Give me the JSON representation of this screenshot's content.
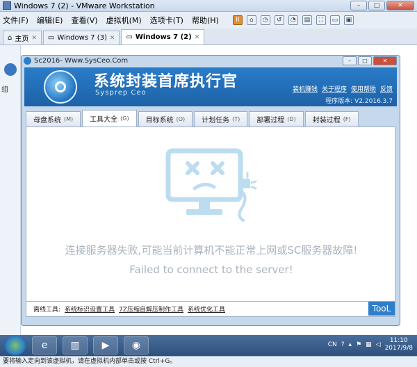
{
  "vm": {
    "title": "Windows 7 (2) - VMware Workstation",
    "menu": [
      "文件(F)",
      "编辑(E)",
      "查看(V)",
      "虚拟机(M)",
      "选项卡(T)",
      "帮助(H)"
    ],
    "tabs": [
      {
        "label": "主页"
      },
      {
        "label": "Windows 7 (3)"
      },
      {
        "label": "Windows 7 (2)"
      }
    ],
    "status": "要将输入定向到该虚拟机，请在虚拟机内部单击或按 Ctrl+G。"
  },
  "guest": {
    "left_text": "组"
  },
  "app": {
    "window_title": "Sc2016- Www.SysCeo.Com",
    "name": "系统封装首席执行官",
    "subtitle": "Sysprep  Ceo",
    "links": [
      "装机赚钱",
      "关于程序",
      "使用帮助",
      "反馈"
    ],
    "version": "程序版本: V2.2016.3.7",
    "tabs": [
      {
        "label": "母盘系统",
        "key": "(M)"
      },
      {
        "label": "工具大全",
        "key": "(G)"
      },
      {
        "label": "目标系统",
        "key": "(O)"
      },
      {
        "label": "计划任务",
        "key": "(T)"
      },
      {
        "label": "部署过程",
        "key": "(D)"
      },
      {
        "label": "封装过程",
        "key": "(F)"
      }
    ],
    "error_cn": "连接服务器失败,可能当前计算机不能正常上网或SC服务器故障!",
    "error_en": "Failed to connect to the server!",
    "footer": {
      "label": "离线工具:",
      "links": [
        "系统标识设置工具",
        "7Z压缩自解压制作工具",
        "系统优化工具"
      ],
      "badge": "TooL"
    }
  },
  "taskbar": {
    "lang": "CN",
    "time": "11:10",
    "date": "2017/9/8"
  }
}
